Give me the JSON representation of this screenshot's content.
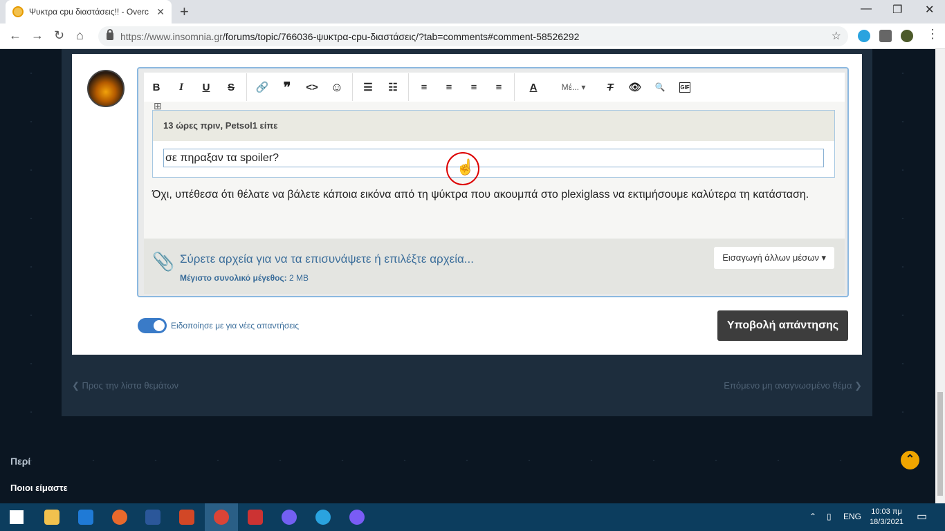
{
  "browser": {
    "tab_title": "Ψυκτρα cpu διαστάσεις!! - Overc",
    "tab_close": "✕",
    "new_tab": "+",
    "url_host": "https://www.insomnia.gr",
    "url_path": "/forums/topic/766036-ψυκτρα-cpu-διαστάσεις/?tab=comments#comment-58526292",
    "window_controls": [
      "—",
      "❐",
      "✕"
    ]
  },
  "editor": {
    "toolbar": {
      "bold": "B",
      "italic": "I",
      "underline": "U",
      "strike": "S",
      "link": "🔗",
      "quote": "❞",
      "code": "<>",
      "emoji": "☺",
      "bullets": "☰",
      "numbers": "☷",
      "align_left": "≡",
      "align_center": "≡",
      "align_right": "≡",
      "justify": "≡",
      "font_color": "A",
      "size": "Μέ... ▾",
      "clear_format": "T",
      "preview": "👁",
      "find": "🔍",
      "gif": "GIF"
    },
    "quote": {
      "author_line": "13 ώρες πριν, Petsol1 είπε",
      "body": "σε πηραξαν τα spoiler?"
    },
    "reply": "Όχι, υπέθεσα ότι θέλατε να βάλετε κάποια εικόνα από τη ψύκτρα που ακουμπά στο plexiglass να εκτιμήσουμε καλύτερα τη κατάσταση.",
    "attach_text": "Σύρετε αρχεία για να τα επισυνάψετε ή επιλέξτε αρχεία...",
    "attach_limit_label": "Μέγιστο συνολικό μέγεθος:",
    "attach_limit_value": "2 MB",
    "media_button": "Εισαγωγή άλλων μέσων ▾"
  },
  "notify_label": "Ειδοποίησε με για νέες απαντήσεις",
  "submit_label": "Υποβολή απάντησης",
  "nav": {
    "prev": "❮   Προς την λίστα θεμάτων",
    "next": "Επόμενο μη αναγνωσμένο θέμα   ❯"
  },
  "footer": {
    "heading": "Περί",
    "link": "Ποιοι είμαστε"
  },
  "taskbar": {
    "lang": "ENG",
    "time": "10:03 πμ",
    "date": "18/3/2021"
  },
  "colors": {
    "accent": "#3a7bc8",
    "submit": "#3d3d3d",
    "page_bg": "#0b1622"
  }
}
